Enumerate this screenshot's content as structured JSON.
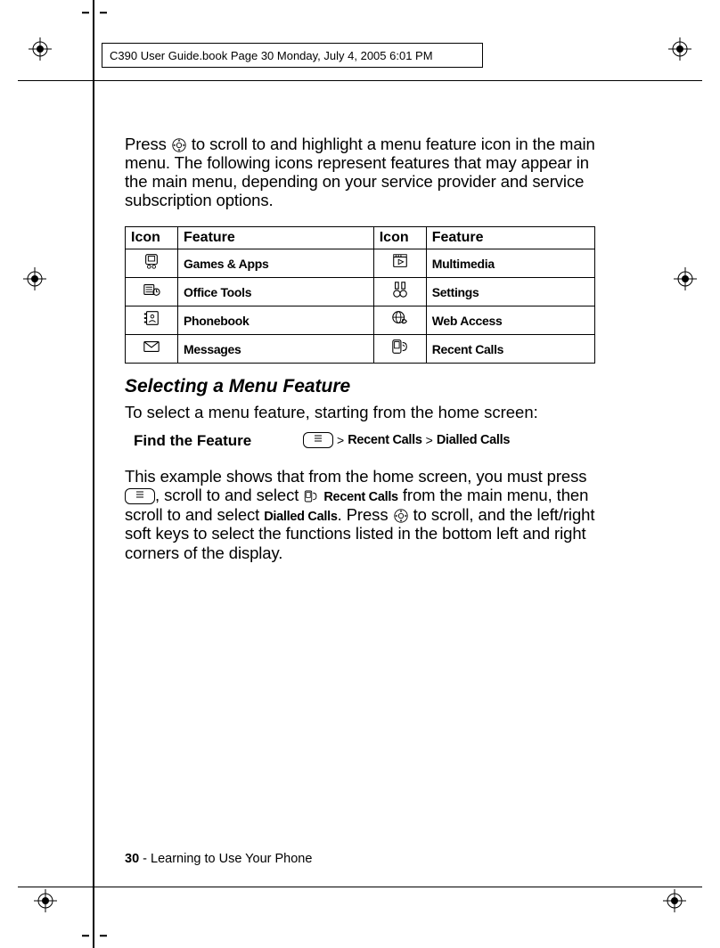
{
  "header": "C390 User Guide.book  Page 30  Monday, July 4, 2005  6:01 PM",
  "intro_pre": "Press ",
  "intro_post": " to scroll to and highlight a menu feature icon in the main menu. The following icons represent features that may appear in the main menu, depending on your service provider and service subscription options.",
  "table": {
    "head": [
      "Icon",
      "Feature",
      "Icon",
      "Feature"
    ],
    "rows": [
      {
        "f1": "Games & Apps",
        "i1": "games-apps-icon",
        "f2": "Multimedia",
        "i2": "multimedia-icon"
      },
      {
        "f1": "Office Tools",
        "i1": "office-tools-icon",
        "f2": "Settings",
        "i2": "settings-icon"
      },
      {
        "f1": "Phonebook",
        "i1": "phonebook-icon",
        "f2": "Web Access",
        "i2": "web-access-icon"
      },
      {
        "f1": "Messages",
        "i1": "messages-icon",
        "f2": "Recent Calls",
        "i2": "recent-calls-icon"
      }
    ]
  },
  "section_heading": "Selecting a Menu Feature",
  "section_sub": "To select a menu feature, starting from the home screen:",
  "find_label": "Find the Feature",
  "find_path": {
    "sep1": ">",
    "seg1": "Recent Calls",
    "sep2": ">",
    "seg2": "Dialled Calls"
  },
  "explain": {
    "t1": "This example shows that from the home screen, you must press ",
    "t2": ", scroll to and select ",
    "t3_emph": "Recent Calls",
    "t4": " from the main menu, then scroll to and select ",
    "t5_emph": "Dialled Calls",
    "t6": ". Press ",
    "t7": " to scroll, and the left/right soft keys to select the functions listed in the bottom left and right corners of the display."
  },
  "footer": {
    "page": "30",
    "sep": " - ",
    "title": "Learning to Use Your Phone"
  }
}
